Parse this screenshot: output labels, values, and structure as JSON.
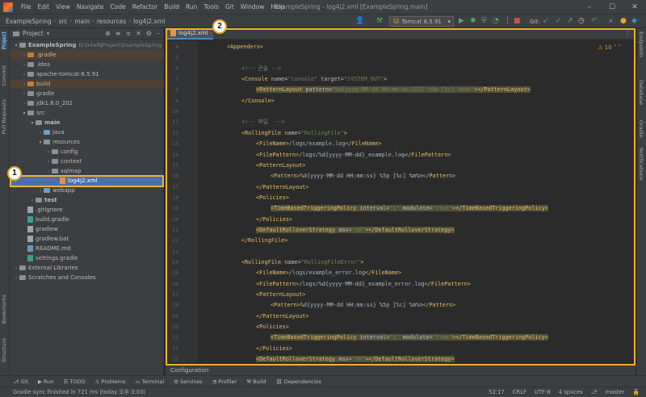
{
  "menu": {
    "items": [
      "File",
      "Edit",
      "View",
      "Navigate",
      "Code",
      "Refactor",
      "Build",
      "Run",
      "Tools",
      "Git",
      "Window",
      "Help"
    ],
    "window_title": "ExampleSpring - log4j2.xml [ExampleSpring.main]"
  },
  "breadcrumbs": [
    "ExampleSpring",
    "src",
    "main",
    "resources",
    "log4j2.xml"
  ],
  "toolbar": {
    "run_config": "Tomcat 8.5.91",
    "git_label": "Git:"
  },
  "project_panel": {
    "title": "Project",
    "tree": [
      {
        "label": "ExampleSpring",
        "hint": "D:\\IntelliJProject\\ExampleSpring",
        "depth": 0,
        "kind": "folder-plain",
        "arrow": "▾",
        "state": ""
      },
      {
        "label": ".gradle",
        "hint": "",
        "depth": 1,
        "kind": "folder-orange",
        "arrow": "›",
        "state": "excluded"
      },
      {
        "label": ".idea",
        "hint": "",
        "depth": 1,
        "kind": "folder-plain",
        "arrow": "›",
        "state": ""
      },
      {
        "label": "apache-tomcat-8.5.91",
        "hint": "",
        "depth": 1,
        "kind": "folder-plain",
        "arrow": "›",
        "state": ""
      },
      {
        "label": "build",
        "hint": "",
        "depth": 1,
        "kind": "folder-orange",
        "arrow": "›",
        "state": "excluded"
      },
      {
        "label": "gradle",
        "hint": "",
        "depth": 1,
        "kind": "folder-plain",
        "arrow": "›",
        "state": ""
      },
      {
        "label": "jdk1.8.0_202",
        "hint": "",
        "depth": 1,
        "kind": "folder-plain",
        "arrow": "›",
        "state": ""
      },
      {
        "label": "src",
        "hint": "",
        "depth": 1,
        "kind": "folder-plain",
        "arrow": "▾",
        "state": ""
      },
      {
        "label": "main",
        "hint": "",
        "depth": 2,
        "kind": "folder-plain",
        "arrow": "▾",
        "state": ""
      },
      {
        "label": "java",
        "hint": "",
        "depth": 3,
        "kind": "folder-blue",
        "arrow": "›",
        "state": ""
      },
      {
        "label": "resources",
        "hint": "",
        "depth": 3,
        "kind": "folder-plain",
        "arrow": "▾",
        "state": ""
      },
      {
        "label": "config",
        "hint": "",
        "depth": 4,
        "kind": "folder-plain",
        "arrow": "›",
        "state": ""
      },
      {
        "label": "context",
        "hint": "",
        "depth": 4,
        "kind": "folder-plain",
        "arrow": "›",
        "state": ""
      },
      {
        "label": "sqlmap",
        "hint": "",
        "depth": 4,
        "kind": "folder-plain",
        "arrow": "›",
        "state": ""
      },
      {
        "label": "log4j2.xml",
        "hint": "",
        "depth": 5,
        "kind": "file-xml",
        "arrow": "",
        "state": "selected"
      },
      {
        "label": "webapp",
        "hint": "",
        "depth": 3,
        "kind": "folder-blue",
        "arrow": "›",
        "state": ""
      },
      {
        "label": "test",
        "hint": "",
        "depth": 2,
        "kind": "folder-plain",
        "arrow": "›",
        "state": ""
      },
      {
        "label": ".gitignore",
        "hint": "",
        "depth": 1,
        "kind": "file-plain",
        "arrow": "",
        "state": ""
      },
      {
        "label": "build.gradle",
        "hint": "",
        "depth": 1,
        "kind": "file-gradle",
        "arrow": "",
        "state": ""
      },
      {
        "label": "gradlew",
        "hint": "",
        "depth": 1,
        "kind": "file-plain",
        "arrow": "",
        "state": ""
      },
      {
        "label": "gradlew.bat",
        "hint": "",
        "depth": 1,
        "kind": "file-plain",
        "arrow": "",
        "state": ""
      },
      {
        "label": "README.md",
        "hint": "",
        "depth": 1,
        "kind": "file-md",
        "arrow": "",
        "state": ""
      },
      {
        "label": "settings.gradle",
        "hint": "",
        "depth": 1,
        "kind": "file-gradle",
        "arrow": "",
        "state": ""
      },
      {
        "label": "External Libraries",
        "hint": "",
        "depth": 0,
        "kind": "folder-plain",
        "arrow": "›",
        "state": ""
      },
      {
        "label": "Scratches and Consoles",
        "hint": "",
        "depth": 0,
        "kind": "folder-plain",
        "arrow": "›",
        "state": ""
      }
    ]
  },
  "side_tabs": {
    "left": [
      "Project",
      "Commit",
      "Pull Requests",
      "Bookmarks",
      "Structure"
    ],
    "right": [
      "Endpoints",
      "Database",
      "Gradle",
      "Notifications"
    ]
  },
  "annotations": {
    "badge1": "1",
    "badge2": "2"
  },
  "editor": {
    "tab_label": "log4j2.xml",
    "warning_count": "10",
    "lines": [
      {
        "n": "4",
        "indent": 1,
        "parts": [
          [
            "tag",
            "<Appenders>"
          ]
        ],
        "hl": false
      },
      {
        "n": "5",
        "indent": 0,
        "parts": [],
        "hl": false
      },
      {
        "n": "6",
        "indent": 2,
        "parts": [
          [
            "cmt",
            "<!-- 콘솔 -->"
          ]
        ],
        "hl": false
      },
      {
        "n": "7",
        "indent": 2,
        "parts": [
          [
            "tag",
            "<Console "
          ],
          [
            "attr",
            "name="
          ],
          [
            "val",
            "\"console\""
          ],
          [
            "attr",
            " target="
          ],
          [
            "val",
            "\"SYSTEM_OUT\""
          ],
          [
            "tag",
            ">"
          ]
        ],
        "hl": false
      },
      {
        "n": "8",
        "indent": 3,
        "parts": [
          [
            "tag",
            "<PatternLayout "
          ],
          [
            "attr",
            "pattern="
          ],
          [
            "val",
            "\"%d{yyyy-MM-dd HH:mm:ss.SSS} %5p [%c] %m%n\""
          ],
          [
            "tag",
            "></PatternLayout>"
          ]
        ],
        "hl": true
      },
      {
        "n": "9",
        "indent": 2,
        "parts": [
          [
            "tag",
            "</Console>"
          ]
        ],
        "hl": false
      },
      {
        "n": "10",
        "indent": 0,
        "parts": [],
        "hl": false
      },
      {
        "n": "11",
        "indent": 2,
        "parts": [
          [
            "cmt",
            "<!-- 파일  -->"
          ]
        ],
        "hl": false
      },
      {
        "n": "12",
        "indent": 2,
        "parts": [
          [
            "tag",
            "<RollingFile "
          ],
          [
            "attr",
            "name="
          ],
          [
            "val",
            "\"RollingFile\""
          ],
          [
            "tag",
            ">"
          ]
        ],
        "hl": false
      },
      {
        "n": "13",
        "indent": 3,
        "parts": [
          [
            "tag",
            "<FileName>"
          ],
          [
            "txt",
            "/logs/example.log"
          ],
          [
            "tag",
            "</FileName>"
          ]
        ],
        "hl": false
      },
      {
        "n": "14",
        "indent": 3,
        "parts": [
          [
            "tag",
            "<FilePattern>"
          ],
          [
            "txt",
            "/logs/%d{yyyy-MM-dd}_example.log"
          ],
          [
            "tag",
            "</FilePattern>"
          ]
        ],
        "hl": false
      },
      {
        "n": "15",
        "indent": 3,
        "parts": [
          [
            "tag",
            "<PatternLayout>"
          ]
        ],
        "hl": false
      },
      {
        "n": "16",
        "indent": 4,
        "parts": [
          [
            "tag",
            "<Pattern>"
          ],
          [
            "txt",
            "%d{yyyy-MM-dd HH:mm:ss} %5p [%c] %m%n"
          ],
          [
            "tag",
            "</Pattern>"
          ]
        ],
        "hl": false
      },
      {
        "n": "17",
        "indent": 3,
        "parts": [
          [
            "tag",
            "</PatternLayout>"
          ]
        ],
        "hl": false
      },
      {
        "n": "18",
        "indent": 3,
        "parts": [
          [
            "tag",
            "<Policies>"
          ]
        ],
        "hl": false
      },
      {
        "n": "19",
        "indent": 4,
        "parts": [
          [
            "tag",
            "<TimeBasedTriggeringPolicy "
          ],
          [
            "attr",
            "interval="
          ],
          [
            "val",
            "\"1\""
          ],
          [
            "attr",
            " modulate="
          ],
          [
            "val",
            "\"true\""
          ],
          [
            "tag",
            "></TimeBasedTriggeringPolicy>"
          ]
        ],
        "hl": true
      },
      {
        "n": "20",
        "indent": 3,
        "parts": [
          [
            "tag",
            "</Policies>"
          ]
        ],
        "hl": false
      },
      {
        "n": "21",
        "indent": 3,
        "parts": [
          [
            "tag",
            "<DefaultRolloverStrategy "
          ],
          [
            "attr",
            "max="
          ],
          [
            "val",
            "\"30\""
          ],
          [
            "tag",
            "></DefaultRolloverStrategy>"
          ]
        ],
        "hl": true
      },
      {
        "n": "22",
        "indent": 2,
        "parts": [
          [
            "tag",
            "</RollingFile>"
          ]
        ],
        "hl": false
      },
      {
        "n": "23",
        "indent": 0,
        "parts": [],
        "hl": false
      },
      {
        "n": "24",
        "indent": 2,
        "parts": [
          [
            "tag",
            "<RollingFile "
          ],
          [
            "attr",
            "name="
          ],
          [
            "val",
            "\"RollingFileError\""
          ],
          [
            "tag",
            ">"
          ]
        ],
        "hl": false
      },
      {
        "n": "25",
        "indent": 3,
        "parts": [
          [
            "tag",
            "<FileName>"
          ],
          [
            "txt",
            "/logs/example_error.log"
          ],
          [
            "tag",
            "</FileName>"
          ]
        ],
        "hl": false
      },
      {
        "n": "26",
        "indent": 3,
        "parts": [
          [
            "tag",
            "<FilePattern>"
          ],
          [
            "txt",
            "/logs/%d{yyyy-MM-dd}_example_error.log"
          ],
          [
            "tag",
            "</FilePattern>"
          ]
        ],
        "hl": false
      },
      {
        "n": "27",
        "indent": 3,
        "parts": [
          [
            "tag",
            "<PatternLayout>"
          ]
        ],
        "hl": false
      },
      {
        "n": "28",
        "indent": 4,
        "parts": [
          [
            "tag",
            "<Pattern>"
          ],
          [
            "txt",
            "%d{yyyy-MM-dd HH:mm:ss} %5p [%c] %m%n"
          ],
          [
            "tag",
            "</Pattern>"
          ]
        ],
        "hl": false
      },
      {
        "n": "29",
        "indent": 3,
        "parts": [
          [
            "tag",
            "</PatternLayout>"
          ]
        ],
        "hl": false
      },
      {
        "n": "30",
        "indent": 3,
        "parts": [
          [
            "tag",
            "<Policies>"
          ]
        ],
        "hl": false
      },
      {
        "n": "31",
        "indent": 4,
        "parts": [
          [
            "tag",
            "<TimeBasedTriggeringPolicy "
          ],
          [
            "attr",
            "interval="
          ],
          [
            "val",
            "\"1\""
          ],
          [
            "attr",
            " modulate="
          ],
          [
            "val",
            "\"true\""
          ],
          [
            "tag",
            "></TimeBasedTriggeringPolicy>"
          ]
        ],
        "hl": true
      },
      {
        "n": "32",
        "indent": 3,
        "parts": [
          [
            "tag",
            "</Policies>"
          ]
        ],
        "hl": false
      },
      {
        "n": "33",
        "indent": 3,
        "parts": [
          [
            "tag",
            "<DefaultRolloverStrategy "
          ],
          [
            "attr",
            "max="
          ],
          [
            "val",
            "\"30\""
          ],
          [
            "tag",
            "></DefaultRolloverStrategy>"
          ]
        ],
        "hl": true
      },
      {
        "n": "34",
        "indent": 2,
        "parts": [
          [
            "tag",
            "</RollingFile>"
          ]
        ],
        "hl": false
      }
    ]
  },
  "config_bar": {
    "label": "Configuration"
  },
  "tool_tabs": [
    "Git",
    "Run",
    "TODO",
    "Problems",
    "Terminal",
    "Services",
    "Profiler",
    "Build",
    "Dependencies"
  ],
  "status": {
    "message": "Gradle sync finished in 721 ms (today 오후 3:03)",
    "position": "52:17",
    "line_sep": "CRLF",
    "encoding": "UTF-8",
    "indent": "4 spaces",
    "branch": "master"
  }
}
